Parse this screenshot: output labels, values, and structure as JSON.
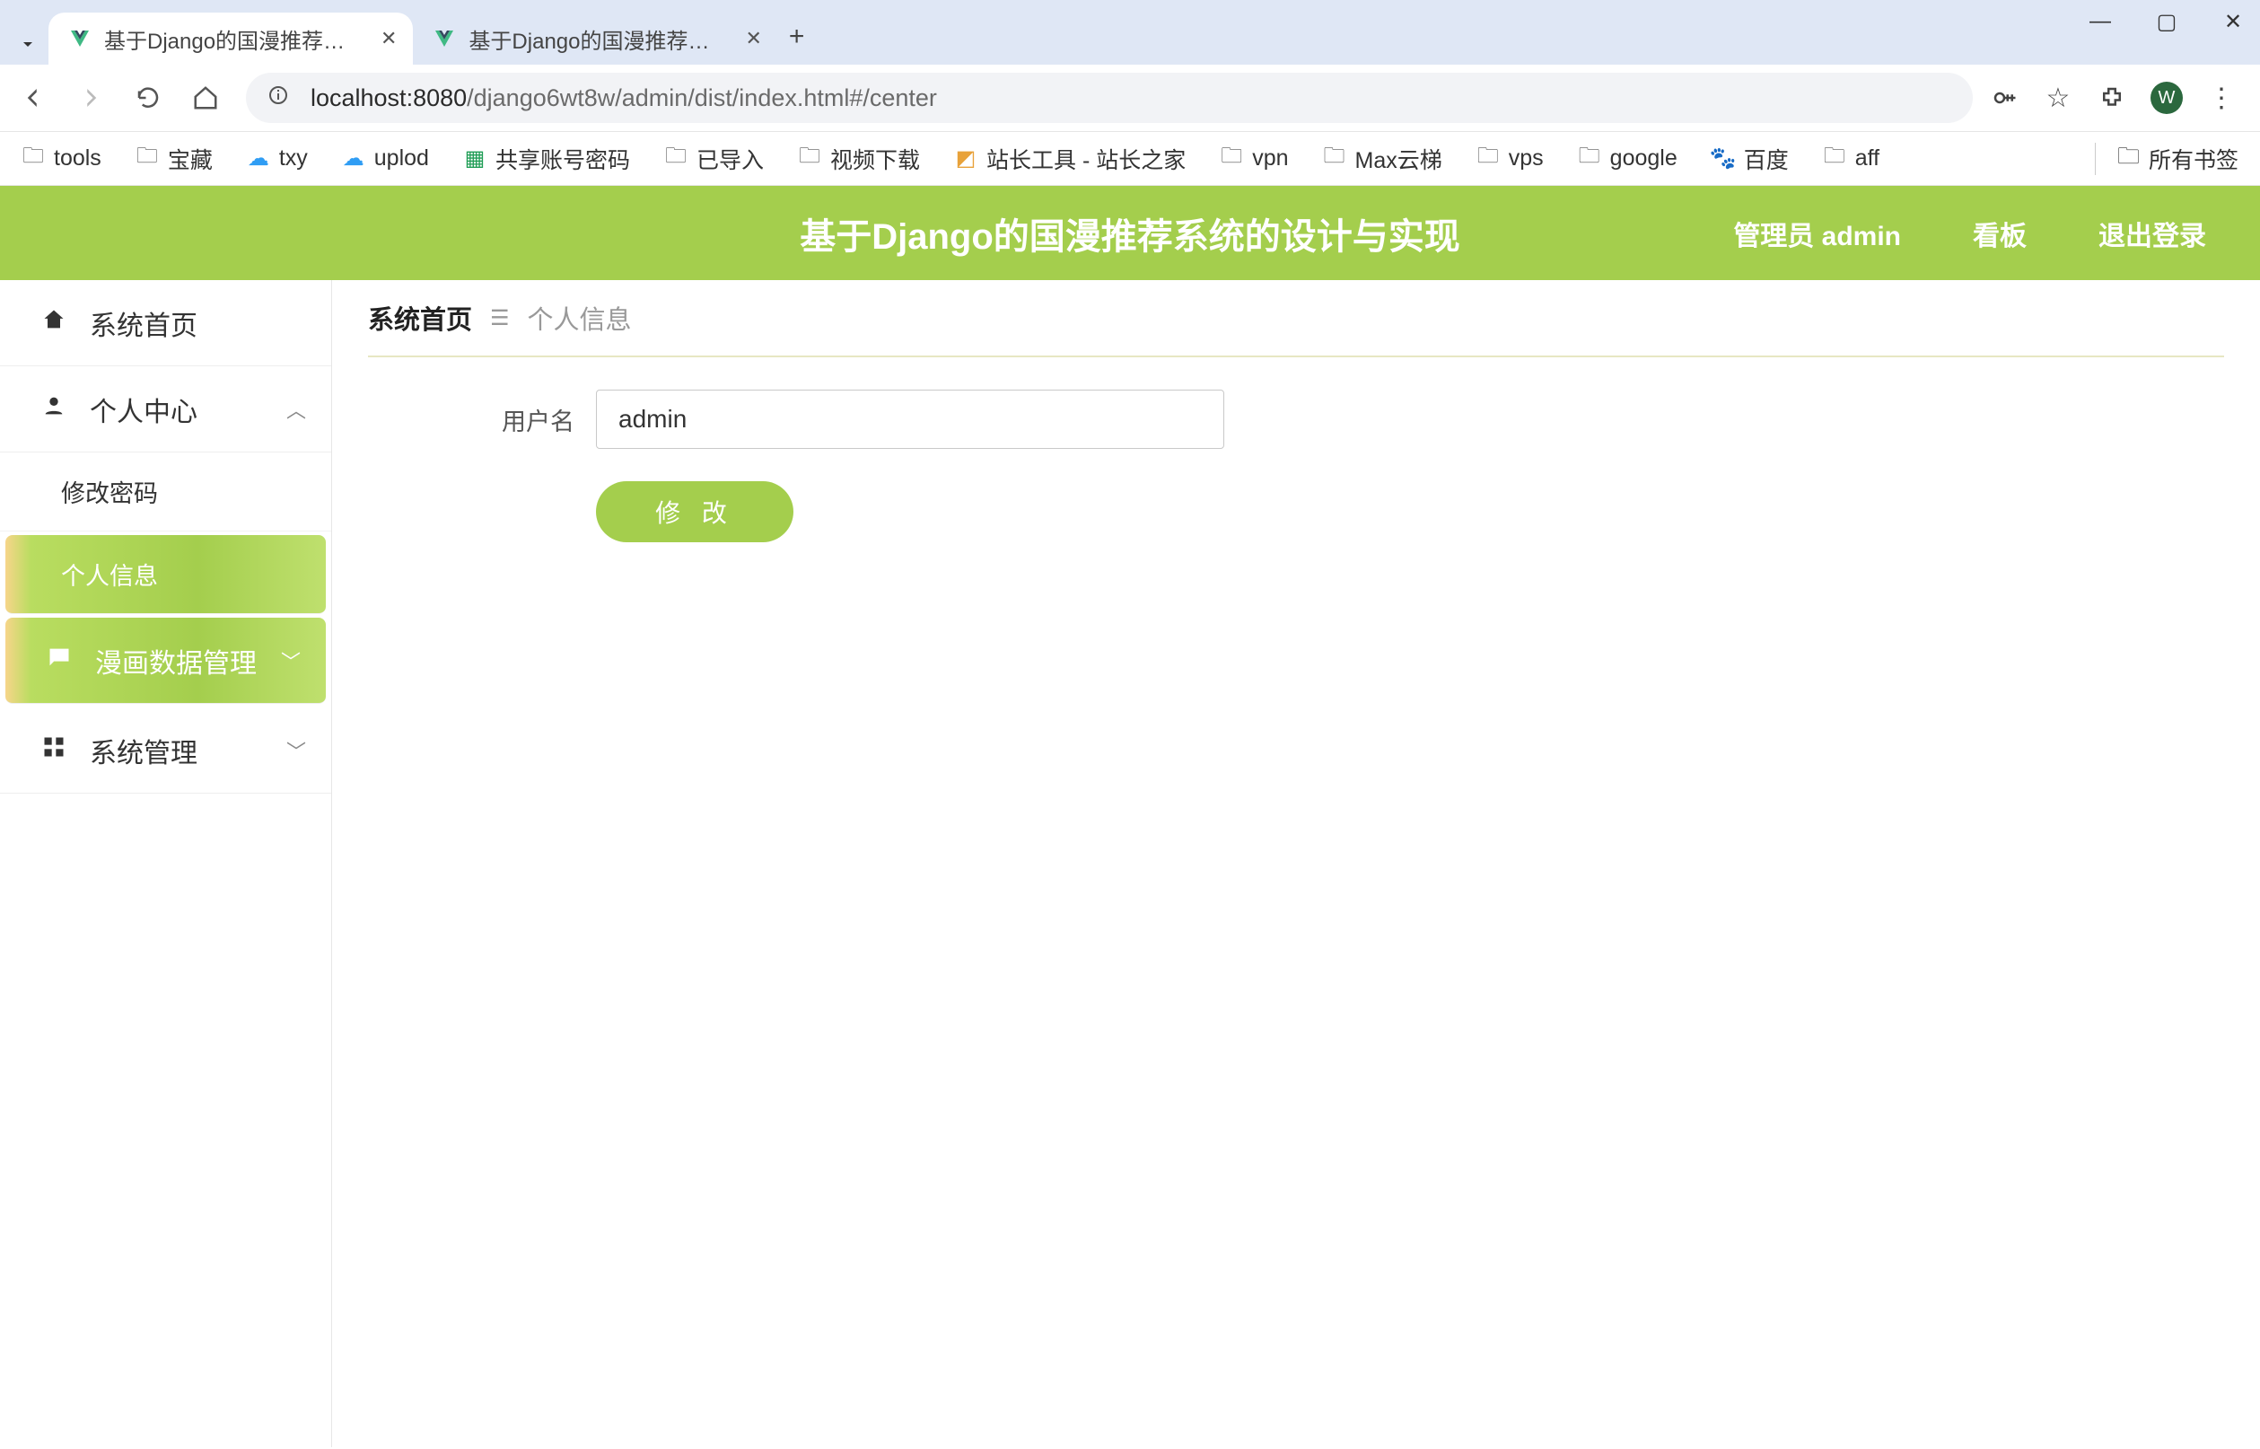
{
  "browser": {
    "tabs": [
      {
        "title": "基于Django的国漫推荐系统的",
        "active": true
      },
      {
        "title": "基于Django的国漫推荐系统的",
        "active": false
      }
    ],
    "url_host": "localhost:8080",
    "url_path": "/django6wt8w/admin/dist/index.html#/center",
    "avatar_letter": "W",
    "bookmarks": [
      {
        "label": "tools",
        "icon": "folder"
      },
      {
        "label": "宝藏",
        "icon": "folder"
      },
      {
        "label": "txy",
        "icon": "cloud"
      },
      {
        "label": "uplod",
        "icon": "cloud"
      },
      {
        "label": "共享账号密码",
        "icon": "sheet"
      },
      {
        "label": "已导入",
        "icon": "folder"
      },
      {
        "label": "视频下载",
        "icon": "folder"
      },
      {
        "label": "站长工具 - 站长之家",
        "icon": "tool"
      },
      {
        "label": "vpn",
        "icon": "folder"
      },
      {
        "label": "Max云梯",
        "icon": "folder"
      },
      {
        "label": "vps",
        "icon": "folder"
      },
      {
        "label": "google",
        "icon": "folder"
      },
      {
        "label": "百度",
        "icon": "paw"
      },
      {
        "label": "aff",
        "icon": "folder"
      }
    ],
    "all_bookmarks_label": "所有书签"
  },
  "app": {
    "title": "基于Django的国漫推荐系统的设计与实现",
    "header_links": {
      "admin": "管理员 admin",
      "board": "看板",
      "logout": "退出登录"
    },
    "sidebar": {
      "home": "系统首页",
      "personal_center": "个人中心",
      "change_pwd": "修改密码",
      "profile": "个人信息",
      "manga_mgmt": "漫画数据管理",
      "sys_mgmt": "系统管理"
    },
    "breadcrumb": {
      "home": "系统首页",
      "current": "个人信息"
    },
    "form": {
      "username_label": "用户名",
      "username_value": "admin",
      "submit_label": "修 改"
    }
  }
}
